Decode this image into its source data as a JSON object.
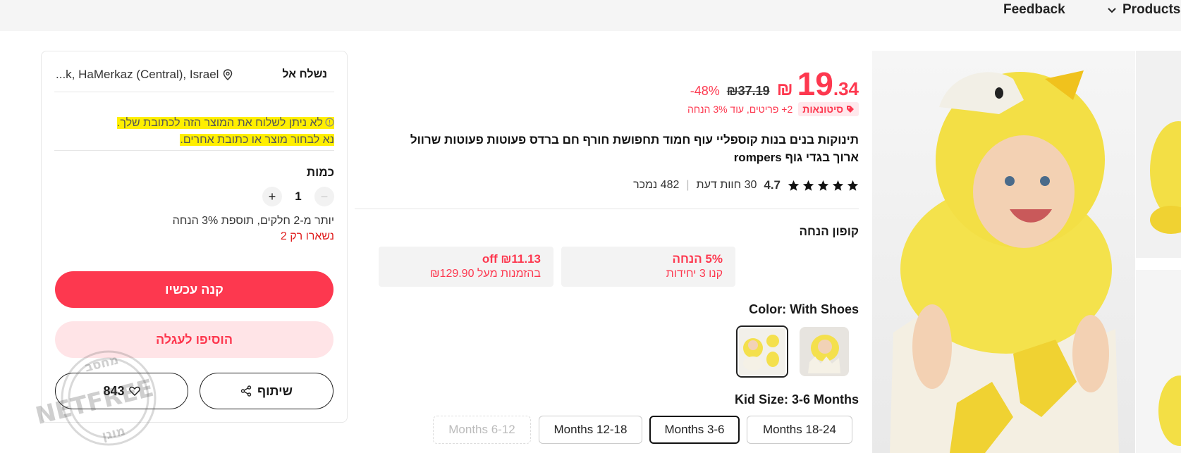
{
  "topnav": {
    "feedback": "Feedback",
    "products": "Products"
  },
  "shipping": {
    "label": "נשלח אל",
    "address": "...k, HaMerkaz (Central), Israel"
  },
  "warning": {
    "line1": "לא ניתן לשלוח את המוצר הזה לכתובת שלך.",
    "line2": "נא לבחור מוצר או כתובת אחרים."
  },
  "quantity": {
    "label": "כמות",
    "value": "1",
    "bulk_note": "יותר מ-2 חלקים, תוספת 3% הנחה",
    "stock_note": "נשארו רק 2"
  },
  "buttons": {
    "buy_now": "קנה עכשיו",
    "add_to_cart": "הוסיפו לעגלה",
    "share": "שיתוף",
    "wishlist_count": "843"
  },
  "price": {
    "currency": "₪",
    "integer": "19",
    "cents": ".34",
    "original": "₪37.19",
    "discount": "-48%"
  },
  "promo": {
    "badge": "סיטונאות",
    "text": "2+ פריטים, עוד 3% הנחה"
  },
  "product": {
    "title": "תינוקות בנים בנות קוספליי עוף חמוד תחפושת חורף חם ברדס פעוטות פעוטות שרוול ארוך בגדי גוף rompers"
  },
  "rating": {
    "score": "4.7",
    "reviews": "30 חוות דעת",
    "sold": "482 נמכר",
    "stars": 5
  },
  "coupons": {
    "title": "קופון הנחה",
    "items": [
      {
        "big": "5% הנחה",
        "small": "קנו 3 יחידות"
      },
      {
        "big": "₪11.13 off",
        "small": "בהזמנות מעל ₪129.90"
      }
    ]
  },
  "color": {
    "label": "Color: With Shoes"
  },
  "size": {
    "label": "Kid Size: 3-6 Months",
    "options": [
      "Months 18-24",
      "Months 3-6",
      "Months 12-18",
      "Months 6-12"
    ]
  },
  "watermark": {
    "text": "NETFREE",
    "top": "מחסב",
    "bottom": "מוגן"
  },
  "colors": {
    "accent": "#fd384f",
    "highlight": "#ffef00"
  }
}
